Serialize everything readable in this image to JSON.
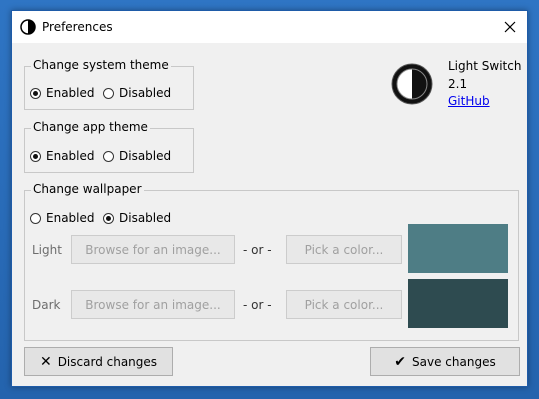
{
  "window": {
    "title": "Preferences",
    "close_symbol": "✕"
  },
  "system_theme": {
    "label": "Change system theme",
    "options": [
      {
        "label": "Enabled",
        "checked": true
      },
      {
        "label": "Disabled",
        "checked": false
      }
    ]
  },
  "app_theme": {
    "label": "Change app theme",
    "options": [
      {
        "label": "Enabled",
        "checked": true
      },
      {
        "label": "Disabled",
        "checked": false
      }
    ]
  },
  "about": {
    "app_name": "Light Switch",
    "version": "2.1",
    "link_text": "GitHub"
  },
  "wallpaper": {
    "label": "Change wallpaper",
    "options": [
      {
        "label": "Enabled",
        "checked": false
      },
      {
        "label": "Disabled",
        "checked": true
      }
    ],
    "light_label": "Light",
    "dark_label": "Dark",
    "browse_label": "Browse for an image...",
    "or_label": "- or -",
    "pick_label": "Pick a color...",
    "light_color": "#4e7d85",
    "dark_color": "#2e4b50"
  },
  "footer": {
    "discard_label": "Discard changes",
    "save_label": "Save changes"
  },
  "colors": {
    "desktop": "#2a6cb8",
    "window_bg": "#f0f0f0"
  }
}
